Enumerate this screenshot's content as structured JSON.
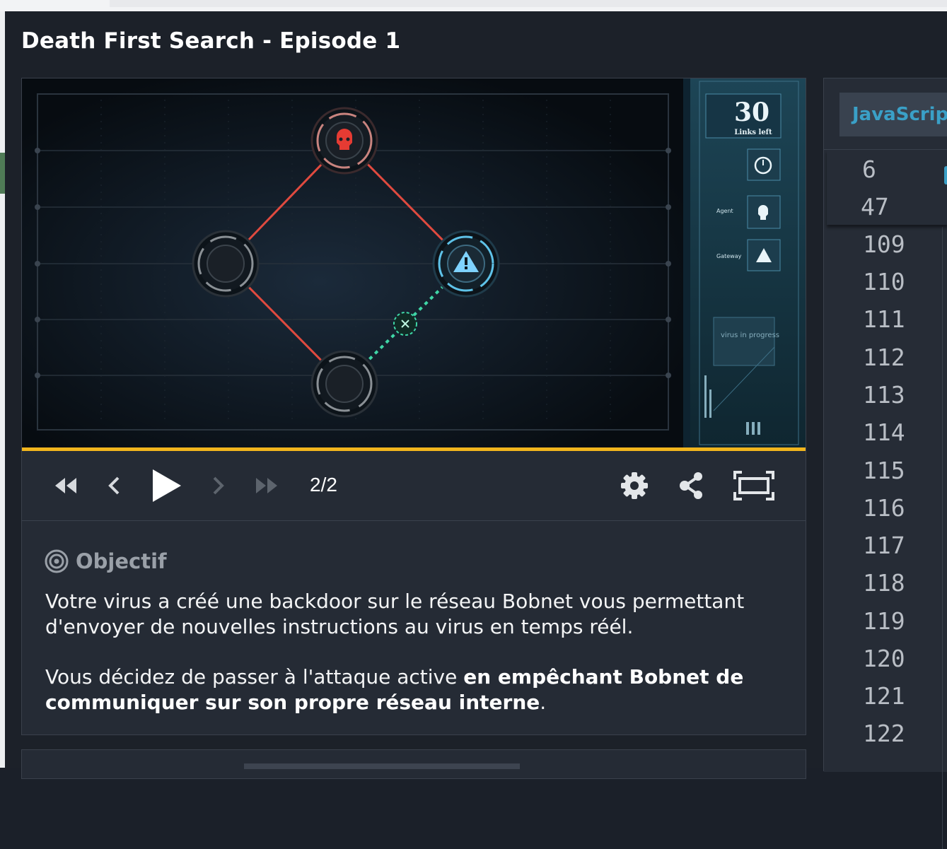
{
  "page": {
    "title": "Death First Search - Episode 1"
  },
  "game": {
    "links_left": "30",
    "links_label": "Links left",
    "hud_labels": [
      "Agent",
      "Gateway",
      "virus in progress"
    ]
  },
  "player": {
    "frame_counter": "2/2",
    "progress_fraction": 1.0,
    "buttons": [
      "rewind-icon",
      "step-back-icon",
      "play-icon",
      "step-forward-icon",
      "fast-forward-icon",
      "settings-icon",
      "share-icon",
      "fullscreen-icon"
    ]
  },
  "statement": {
    "section_title": "Objectif",
    "paragraph1": "Votre virus a créé une backdoor sur le réseau Bobnet vous permettant d'envoyer de nouvelles instructions au virus en temps réél.",
    "paragraph2_prefix": "Vous décidez de passer à l'attaque active ",
    "paragraph2_bold": "en empêchant Bobnet de communiquer sur son propre réseau interne",
    "paragraph2_suffix": "."
  },
  "editor": {
    "language_tab": "JavaScript",
    "sticky_lines": [
      "6",
      "47"
    ],
    "line_numbers": [
      "109",
      "110",
      "111",
      "112",
      "113",
      "114",
      "115",
      "116",
      "117",
      "118",
      "119",
      "120",
      "121",
      "122"
    ]
  },
  "colors": {
    "accent_progress": "#f1b51d",
    "language_tab_text": "#3aa0c7",
    "severed_link": "#e04a3f",
    "active_link": "#3fd6a6",
    "agent_red": "#e63b33",
    "gateway_blue": "#7fd3ff"
  }
}
